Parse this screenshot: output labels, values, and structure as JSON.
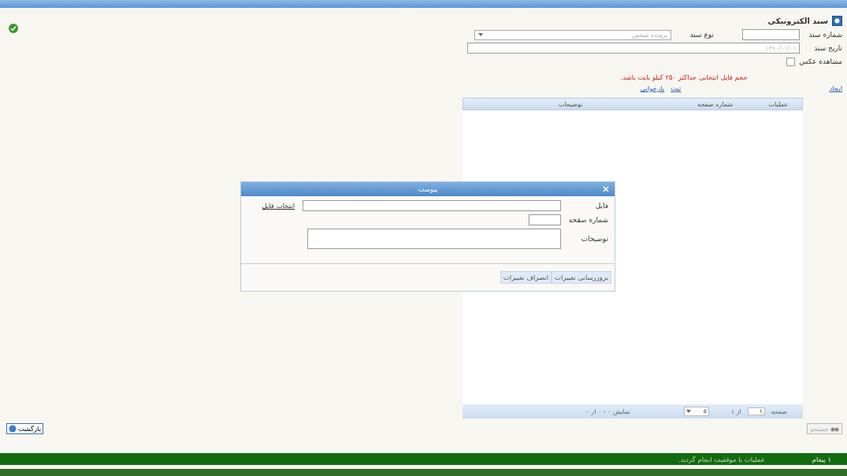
{
  "page": {
    "title": "سند الکترونیکی"
  },
  "form": {
    "doc_number": {
      "label": "شماره سند"
    },
    "doc_type": {
      "label": "نوع سند",
      "value": "پرونده شخص"
    },
    "doc_date": {
      "label": "تاریخ سند",
      "placeholder": "۱۳۹۰/۰۱/۰۱"
    },
    "show_photo": {
      "label": "مشاهده عکس",
      "checked": false
    }
  },
  "warning": "حجم فایل انتخابی حداکثر ۲۵۰ کیلو بایت باشد.",
  "links": [
    {
      "label": "ایجاد"
    },
    {
      "label": "ثبت"
    },
    {
      "label": "بازخوانی"
    }
  ],
  "table": {
    "columns": [
      "عملیات",
      "شماره صفحه",
      "توضیحات"
    ],
    "pager": {
      "page_label": "صفحه",
      "page": "۱",
      "of": "از ۱",
      "page_size": "۵",
      "summary": "نمایش ۰ - ۰ از ۰"
    }
  },
  "dialog": {
    "title": "پیوست",
    "file_label": "فایل",
    "choose_file": "انتخاب فایل",
    "page_label": "شماره صفحه",
    "desc_label": "توضیحات",
    "buttons": [
      {
        "label": "بروزرسانی تغییرات"
      },
      {
        "label": "انصراف تغییرات"
      }
    ]
  },
  "footer": {
    "back_button": "بازگشت",
    "search_button": {
      "label": "جستجو",
      "disabled": true
    }
  },
  "status_bar": {
    "count": "۱ پیغام",
    "message": "عملیات با موفقیت انجام گردید."
  }
}
